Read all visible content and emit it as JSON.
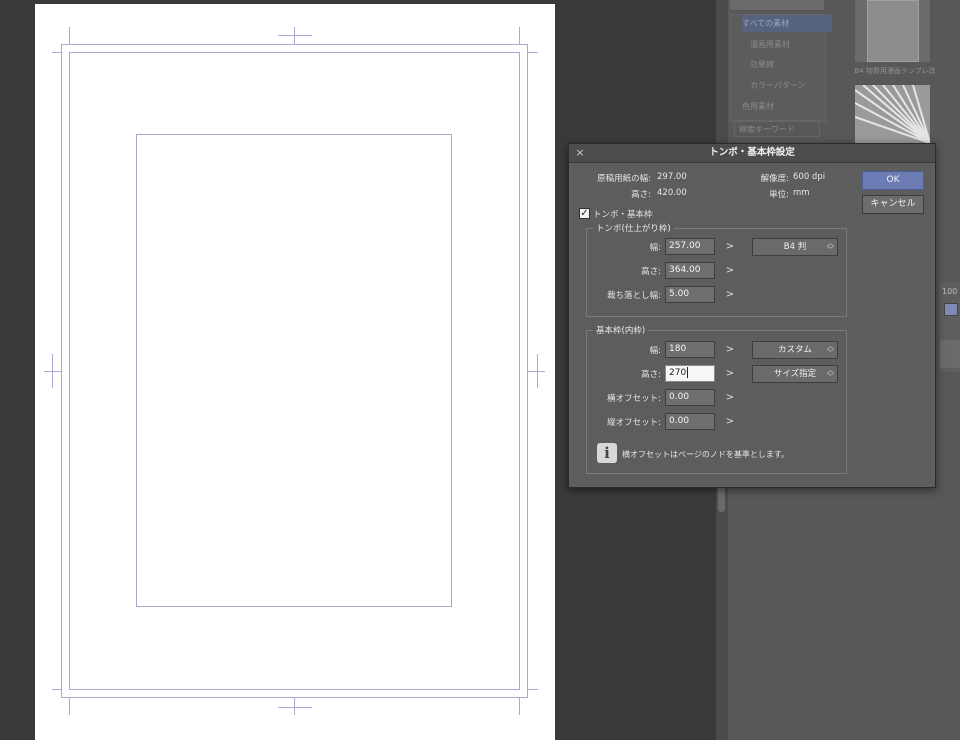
{
  "sidebar": {
    "tree": [
      "すべての素材",
      "漫画用素材",
      "効果線",
      "カラーパターン",
      "色用素材",
      "検索キーワード"
    ],
    "thumb_label": "B4 物質用漫画テンプレ改",
    "side_value": "100"
  },
  "dialog": {
    "title": "トンボ・基本枠設定",
    "close_icon": "×",
    "info": {
      "paper_width_label": "原稿用紙の幅:",
      "paper_width_value": "297.00",
      "paper_height_label": "高さ:",
      "paper_height_value": "420.00",
      "resolution_label": "解像度:",
      "resolution_value": "600 dpi",
      "unit_label": "単位:",
      "unit_value": "mm"
    },
    "ok_label": "OK",
    "cancel_label": "キャンセル",
    "enable_label": "トンボ・基本枠",
    "enable_checked": true,
    "trim": {
      "title": "トンボ(仕上がり枠)",
      "width_label": "幅:",
      "width_value": "257.00",
      "height_label": "高さ:",
      "height_value": "364.00",
      "bleed_label": "裁ち落とし幅:",
      "bleed_value": "5.00",
      "preset": "B4 判"
    },
    "basic": {
      "title": "基本枠(内枠)",
      "width_label": "幅:",
      "width_value": "180",
      "height_label": "高さ:",
      "height_value": "270",
      "hoffset_label": "横オフセット:",
      "hoffset_value": "0.00",
      "voffset_label": "縦オフセット:",
      "voffset_value": "0.00",
      "preset": "カスタム",
      "mode": "サイズ指定"
    },
    "note": "横オフセットはページのノドを基準とします。",
    "chevron": ">"
  }
}
